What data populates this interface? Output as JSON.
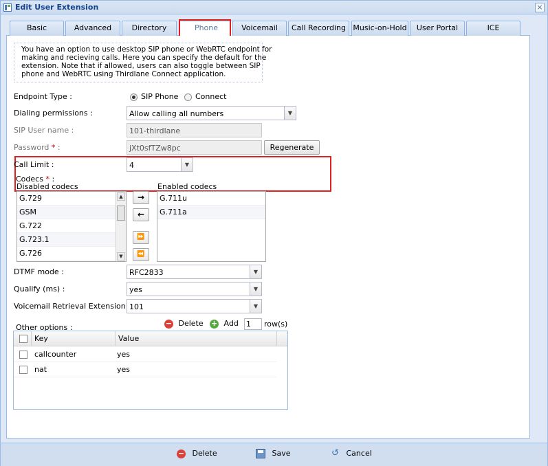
{
  "window": {
    "title": "Edit User Extension"
  },
  "tabs": [
    {
      "label": "Basic"
    },
    {
      "label": "Advanced"
    },
    {
      "label": "Directory"
    },
    {
      "label": "Phone"
    },
    {
      "label": "Voicemail"
    },
    {
      "label": "Call Recording"
    },
    {
      "label": "Music-on-Hold"
    },
    {
      "label": "User Portal"
    },
    {
      "label": "ICE"
    }
  ],
  "active_tab": "Phone",
  "info_lines": [
    "You have an option to use desktop SIP phone or WebRTC endpoint for",
    "making and recieving calls. Here you can specify the default for the",
    "extension. Note that if allowed, users can also toggle between SIP",
    "phone and WebRTC using Thirdlane Connect application."
  ],
  "endpoint_type": {
    "label": "Endpoint Type   :",
    "options": [
      "SIP Phone",
      "Connect"
    ],
    "selected": "SIP Phone"
  },
  "dialing_permissions": {
    "label": "Dialing permissions :",
    "value": "Allow calling all numbers"
  },
  "sip_user_name": {
    "label": "SIP User name  :",
    "value": "101-thirdlane"
  },
  "password": {
    "label": "Password",
    "required_mark": "*",
    "suffix": " :",
    "value": "jXt0sfTZw8pc",
    "regenerate_label": "Regenerate"
  },
  "call_limit": {
    "label": "Call Limit  :",
    "value": "4"
  },
  "codecs": {
    "label": "Codecs",
    "required_mark": "*",
    "suffix": " :",
    "disabled_title": "Disabled codecs",
    "enabled_title": "Enabled codecs",
    "disabled": [
      "G.729",
      "GSM",
      "G.722",
      "G.723.1",
      "G.726"
    ],
    "enabled": [
      "G.711u",
      "G.711a"
    ],
    "move_buttons": [
      "→",
      "←",
      "⏩",
      "⏪"
    ]
  },
  "dtmf_mode": {
    "label": "DTMF mode  :",
    "value": "RFC2833"
  },
  "qualify": {
    "label": "Qualify (ms)  :",
    "value": "yes"
  },
  "voicemail_retrieval": {
    "label": "Voicemail Retrieval Extension  :",
    "value": "101"
  },
  "other_options": {
    "label": "Other options :",
    "delete_label": "Delete",
    "add_label": "Add",
    "rows_count": "1",
    "rows_suffix": "row(s)",
    "columns": [
      "Key",
      "Value"
    ],
    "rows": [
      {
        "key": "callcounter",
        "value": "yes"
      },
      {
        "key": "nat",
        "value": "yes"
      }
    ]
  },
  "footer": {
    "delete_label": "Delete",
    "save_label": "Save",
    "cancel_label": "Cancel"
  },
  "colors": {
    "highlight": "#e02020",
    "header_text": "#15428b",
    "panel_border": "#99bbe8"
  },
  "icons": [
    "window-icon",
    "close-icon",
    "radio-icon",
    "dropdown-arrow-icon",
    "arrow-right-icon",
    "arrow-left-icon",
    "double-arrow-right-icon",
    "double-arrow-left-icon",
    "delete-icon",
    "add-icon",
    "save-icon",
    "cancel-icon"
  ]
}
